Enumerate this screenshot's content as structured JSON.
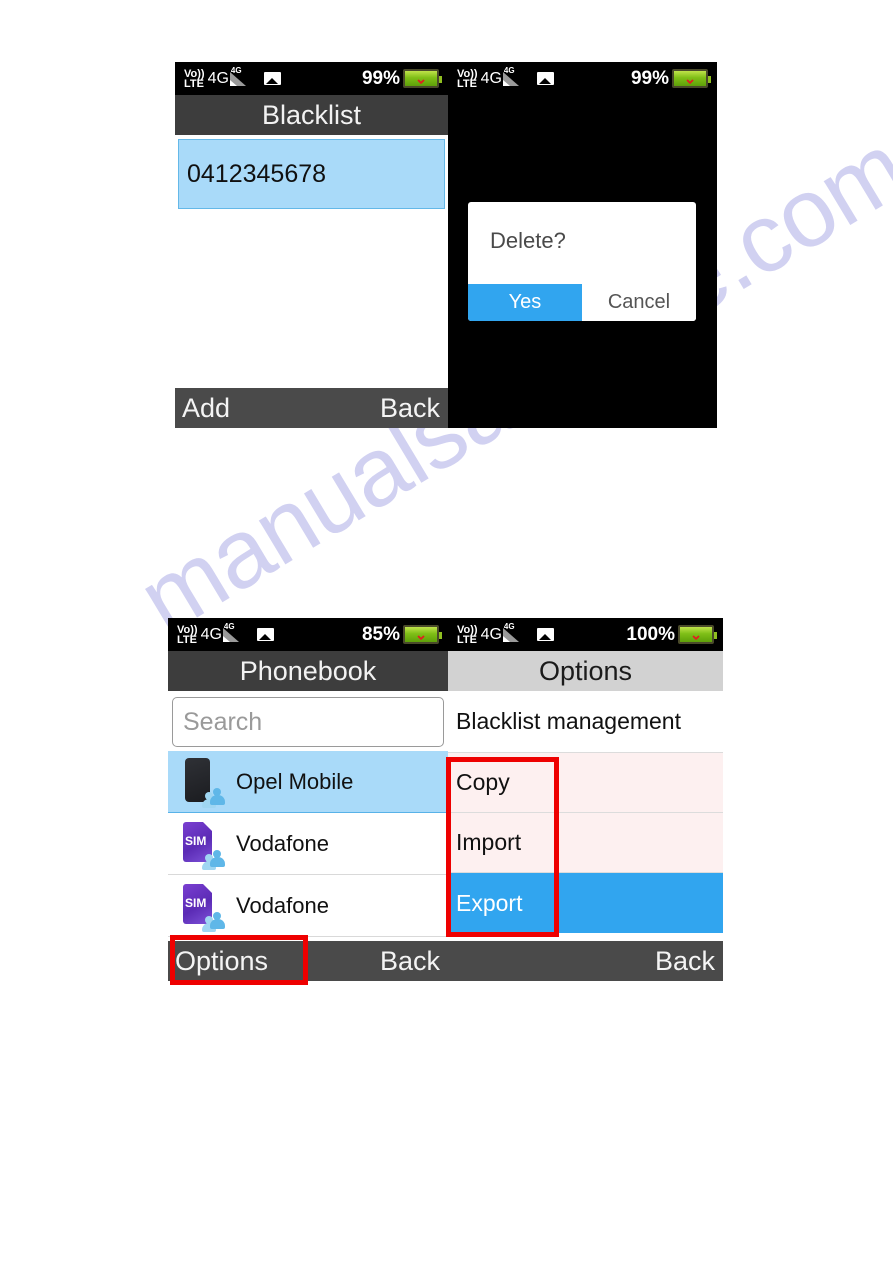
{
  "watermark": {
    "text": "manualsarchive.com"
  },
  "icons": {
    "volte_top": "Vo))",
    "volte_bottom": "LTE",
    "network": "4G",
    "signal_label": "4G",
    "battery_spark": "⌇",
    "sim_label": "SIM"
  },
  "screens": {
    "blacklist": {
      "status": {
        "volte_top": "Vo))",
        "volte_bottom": "LTE",
        "network": "4G",
        "signal": "4G",
        "battery_pct": "99%"
      },
      "title": "Blacklist",
      "entries": [
        "0412345678"
      ],
      "footer": {
        "left": "Add",
        "right": "Back"
      }
    },
    "delete_dialog": {
      "status": {
        "volte_top": "Vo))",
        "volte_bottom": "LTE",
        "network": "4G",
        "signal": "4G",
        "battery_pct": "99%"
      },
      "dialog": {
        "message": "Delete?",
        "confirm": "Yes",
        "cancel": "Cancel"
      }
    },
    "phonebook": {
      "status": {
        "volte_top": "Vo))",
        "volte_bottom": "LTE",
        "network": "4G",
        "signal": "4G",
        "battery_pct": "85%"
      },
      "title": "Phonebook",
      "search_placeholder": "Search",
      "contacts": [
        {
          "name": "Opel Mobile",
          "icon": "phone-contact-icon",
          "selected": true
        },
        {
          "name": "Vodafone",
          "icon": "sim-contact-icon",
          "selected": false
        },
        {
          "name": "Vodafone",
          "icon": "sim-contact-icon",
          "selected": false
        }
      ],
      "footer": {
        "left": "Options",
        "right": "Back"
      }
    },
    "options": {
      "status": {
        "volte_top": "Vo))",
        "volte_bottom": "LTE",
        "network": "4G",
        "signal": "4G",
        "battery_pct": "100%"
      },
      "title": "Options",
      "items": [
        {
          "label": "Blacklist management",
          "state": "normal"
        },
        {
          "label": "Copy",
          "state": "normal"
        },
        {
          "label": "Import",
          "state": "normal"
        },
        {
          "label": "Export",
          "state": "highlighted"
        }
      ],
      "footer": {
        "right": "Back"
      }
    }
  },
  "annotations": {
    "options_button_box": "red-highlight-options-button",
    "options_menu_box": "red-highlight-menu-items"
  },
  "colors": {
    "accent_blue": "#31a5ef",
    "selection_blue": "#a9daf9",
    "highlight_red": "#ee0000",
    "titlebar_dark": "#3d3d3d",
    "titlebar_light": "#d2d2d2",
    "footer_gray": "#4a4a4a",
    "sim_purple": "#5b2bb5",
    "battery_green": "#7fbf17"
  }
}
